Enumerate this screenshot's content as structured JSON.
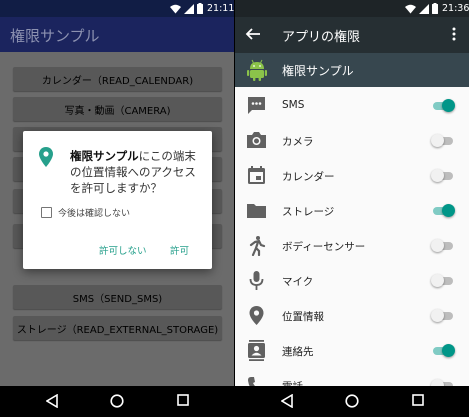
{
  "left": {
    "status_time": "21:11",
    "title": "権限サンプル",
    "buttons": [
      {
        "label": "カレンダー（READ_CALENDAR)"
      },
      {
        "label": "写真・動画（CAMERA)"
      },
      {
        "label": ""
      },
      {
        "label": ""
      },
      {
        "label": ""
      },
      {
        "label": ""
      },
      {
        "label": "SMS（SEND_SMS)"
      },
      {
        "label": "ストレージ（READ_EXTERNAL_STORAGE)"
      }
    ],
    "dialog": {
      "app_name": "権限サンプル",
      "message_rest": "にこの端末の位置情報へのアクセスを許可しますか？",
      "checkbox_label": "今後は確認しない",
      "deny_label": "許可しない",
      "allow_label": "許可"
    }
  },
  "right": {
    "status_time": "21:36",
    "title": "アプリの権限",
    "app_name": "権限サンプル",
    "permissions": [
      {
        "label": "SMS",
        "icon": "sms-icon",
        "enabled": true
      },
      {
        "label": "カメラ",
        "icon": "camera-icon",
        "enabled": false
      },
      {
        "label": "カレンダー",
        "icon": "calendar-icon",
        "enabled": false
      },
      {
        "label": "ストレージ",
        "icon": "folder-icon",
        "enabled": true
      },
      {
        "label": "ボディーセンサー",
        "icon": "body-sensor-icon",
        "enabled": false
      },
      {
        "label": "マイク",
        "icon": "mic-icon",
        "enabled": false
      },
      {
        "label": "位置情報",
        "icon": "location-icon",
        "enabled": false
      },
      {
        "label": "連絡先",
        "icon": "contacts-icon",
        "enabled": true
      },
      {
        "label": "電話",
        "icon": "phone-icon",
        "enabled": false
      }
    ]
  },
  "colors": {
    "accent": "#009688",
    "dialog_button": "#27a08c",
    "left_appbar": "#1b245e",
    "right_appbar": "#262f33"
  }
}
